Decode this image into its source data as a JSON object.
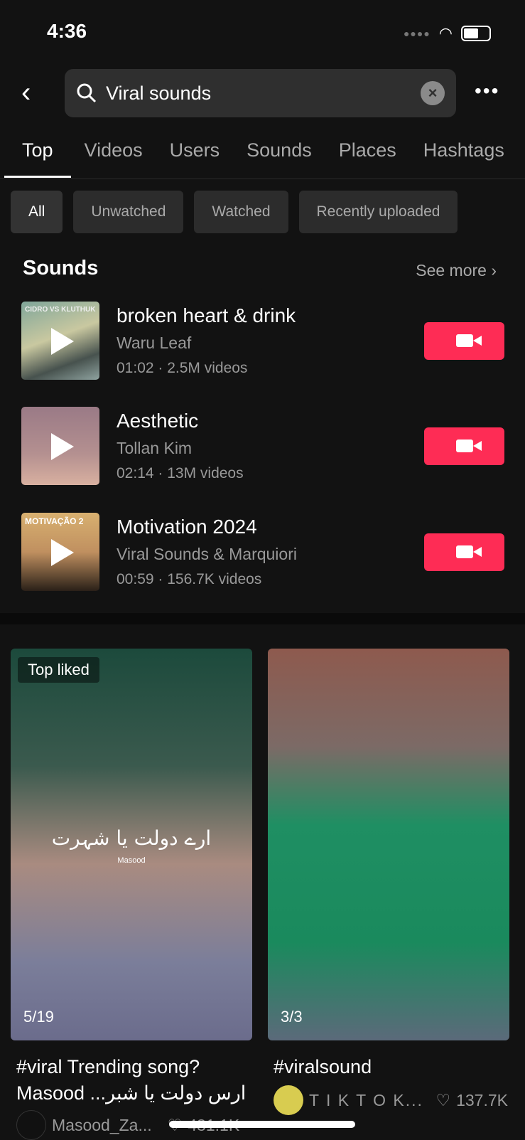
{
  "status": {
    "time": "4:36"
  },
  "search": {
    "query": "Viral sounds",
    "more": "•••"
  },
  "tabs": [
    "Top",
    "Videos",
    "Users",
    "Sounds",
    "Places",
    "Hashtags"
  ],
  "filters": [
    "All",
    "Unwatched",
    "Watched",
    "Recently uploaded"
  ],
  "sounds": {
    "title": "Sounds",
    "see_more": "See more ›",
    "items": [
      {
        "title": "broken heart & drink",
        "artist": "Waru Leaf",
        "meta": "01:02 · 2.5M videos",
        "cover_text": "CIDRO VS KLUTHUK"
      },
      {
        "title": "Aesthetic",
        "artist": "Tollan Kim",
        "meta": "02:14 · 13M videos",
        "cover_text": ""
      },
      {
        "title": "Motivation 2024",
        "artist": "Viral Sounds & Marquiori",
        "meta": "00:59 · 156.7K videos",
        "cover_text": "MOTIVAÇÃO 2"
      }
    ]
  },
  "videos": [
    {
      "badge": "Top liked",
      "counter": "5/19",
      "overlay_text": "ارے دولت یا شہرت",
      "overlay_name": "Masood",
      "caption": "#viral Trending song? Masood ...ارس دولت یا شبر",
      "user": "Masood_Za...",
      "likes": "481.1K"
    },
    {
      "badge": "",
      "counter": "3/3",
      "caption": "#viralsound",
      "user": "T I K T O K...",
      "likes": "137.7K"
    }
  ],
  "colors": {
    "accent": "#fe2c55",
    "background": "#121212"
  }
}
